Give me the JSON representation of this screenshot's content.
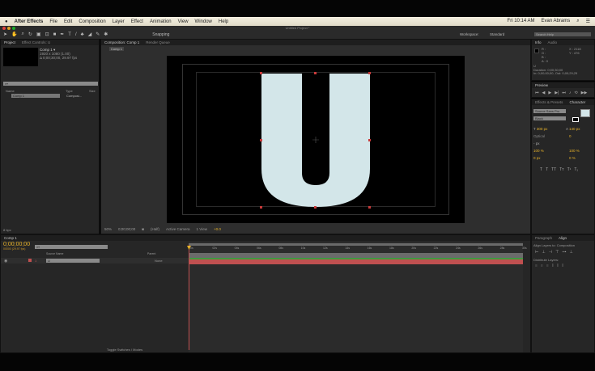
{
  "menubar": {
    "apple": "",
    "app": "After Effects",
    "items": [
      "File",
      "Edit",
      "Composition",
      "Layer",
      "Effect",
      "Animation",
      "View",
      "Window",
      "Help"
    ],
    "clock": "Fri 10:14 AM",
    "user": "Evan Abrams"
  },
  "title": "Untitled Project *",
  "toolbar": {
    "snapping": "Snapping",
    "workspace_label": "Workspace:",
    "workspace": "Standard",
    "search_placeholder": "Search Help"
  },
  "project": {
    "tabs": [
      "Project",
      "Effect Controls: U"
    ],
    "comp_name": "Comp 1 ▾",
    "comp_size": "1920 x 1080 (1.00)",
    "comp_dur": "Δ 0;00;30;00, 29.97 fps",
    "search": "⌕▾",
    "cols": [
      "Name",
      "Type",
      "Size"
    ],
    "items": [
      {
        "name": "Comp 1",
        "type": "Composi..."
      }
    ],
    "bpc": "8 bpc"
  },
  "comp": {
    "tabs": [
      "Composition: Comp 1",
      "Render Queue"
    ],
    "subtab": "Comp 1",
    "zoom": "50%",
    "time": "0;00;00;00",
    "res": "(Half)",
    "camera": "Active Camera",
    "views": "1 View",
    "exposure": "+0.0",
    "letter": "U"
  },
  "info": {
    "tabs": [
      "Info",
      "Audio"
    ],
    "r": "R :",
    "g": "G :",
    "b": "B :",
    "a": "A : 0",
    "x": "X : 2118",
    "y": "Y : 476",
    "layer": "U",
    "duration": "Duration: 0;00;30;00",
    "inout": "In: 0;00;00;00, Out: 0;00;29;29"
  },
  "preview": {
    "tab": "Preview"
  },
  "character": {
    "tabs": [
      "Effects & Presets",
      "Character"
    ],
    "font": "Source Sans Pro",
    "style": "Black",
    "size": "300 px",
    "leading": "140 px",
    "tracking_label": "Optical",
    "tracking": "0",
    "stroke": "- px",
    "vscale": "100 %",
    "hscale": "100 %",
    "baseline": "0 px",
    "tsume": "0 %"
  },
  "timeline": {
    "tab": "Comp 1",
    "timecode": "0;00;00;00",
    "fps": "00000 (29.97 fps)",
    "search": "⌕▾",
    "ticks": [
      "0s",
      "02s",
      "04s",
      "06s",
      "08s",
      "10s",
      "12s",
      "14s",
      "16s",
      "18s",
      "20s",
      "22s",
      "24s",
      "26s",
      "28s",
      "30s"
    ],
    "cols": {
      "source": "Source Name",
      "parent": "Parent"
    },
    "layer": {
      "num": "1",
      "name": "U",
      "parent": "None"
    },
    "toggle": "Toggle Switches / Modes"
  },
  "align": {
    "tabs": [
      "Paragraph",
      "Align"
    ],
    "align_to_label": "Align Layers to:",
    "align_to": "Composition",
    "distribute": "Distribute Layers:"
  },
  "colors": {
    "letter": "#d3e6e9",
    "handle": "#c83a3a",
    "green": "#3f9b3f",
    "red": "#c05050",
    "accent": "#e8b32a"
  }
}
